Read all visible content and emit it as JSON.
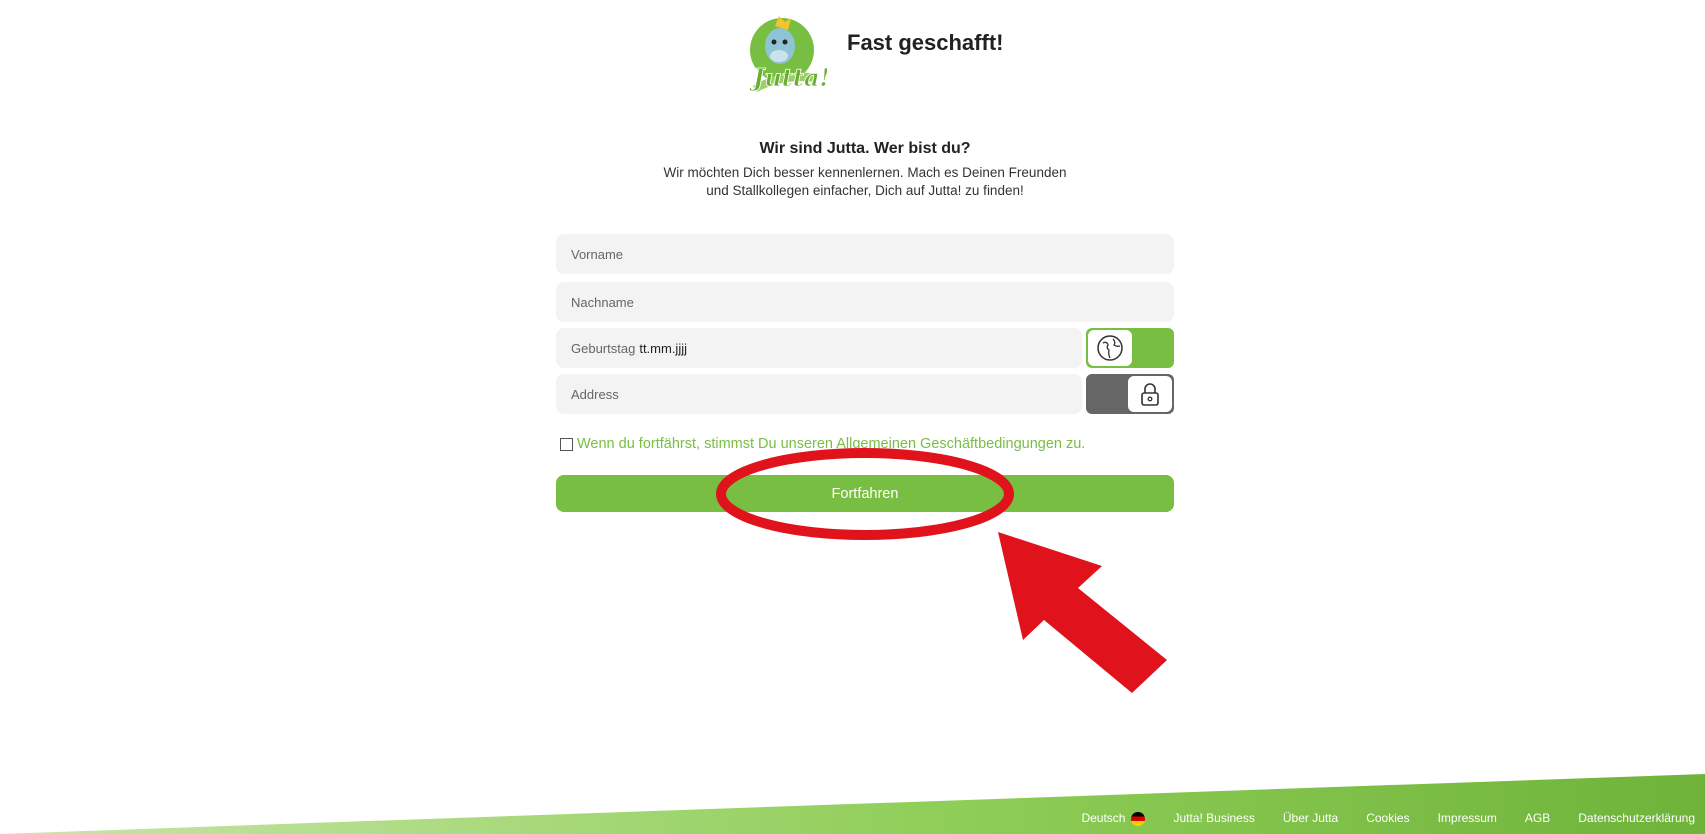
{
  "header": {
    "title": "Fast geschafft!",
    "logo_text": "Jutta!"
  },
  "intro": {
    "heading": "Wir sind Jutta. Wer bist du?",
    "line1": "Wir möchten Dich besser kennenlernen. Mach es Deinen Freunden",
    "line2": "und Stallkollegen einfacher, Dich auf Jutta! zu finden!"
  },
  "form": {
    "vorname_placeholder": "Vorname",
    "nachname_placeholder": "Nachname",
    "birthday_label": "Geburtstag",
    "birthday_value": "tt.mm.jjjj",
    "address_placeholder": "Address",
    "birthday_visibility": "public",
    "address_visibility": "private",
    "agb_text": "Wenn du fortfährst, stimmst Du unseren Allgemeinen Geschäftbedingungen zu.",
    "submit_label": "Fortfahren"
  },
  "footer": {
    "links": [
      "Deutsch",
      "Jutta! Business",
      "Über Jutta",
      "Cookies",
      "Impressum",
      "AGB",
      "Datenschutzerklärung"
    ]
  },
  "colors": {
    "brand_green": "#78be43",
    "toggle_gray": "#666666",
    "annotation_red": "#e0121b"
  },
  "icons": {
    "public_toggle": "globe-icon",
    "private_toggle": "lock-icon",
    "language_flag": "german-flag-icon"
  }
}
